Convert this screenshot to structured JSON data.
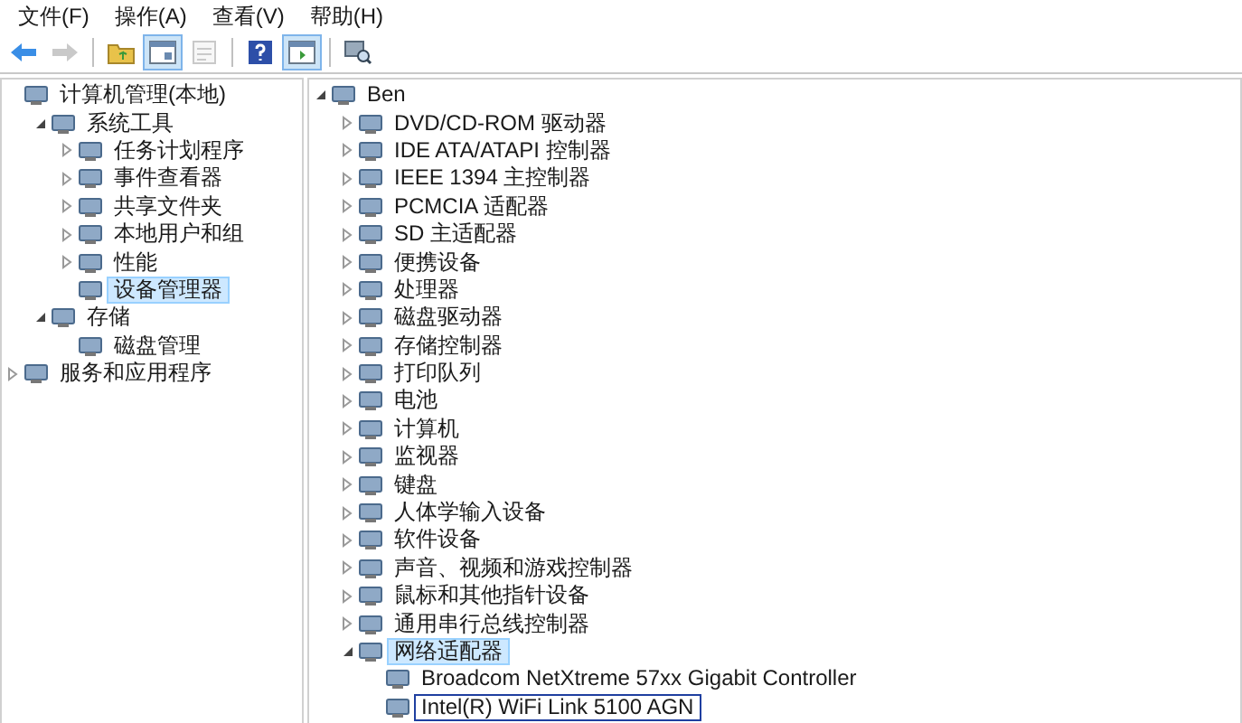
{
  "menu": [
    "文件(F)",
    "操作(A)",
    "查看(V)",
    "帮助(H)"
  ],
  "toolbar": [
    {
      "kind": "back",
      "pressed": false,
      "disabled": false
    },
    {
      "kind": "forward",
      "pressed": false,
      "disabled": true
    },
    {
      "kind": "separator"
    },
    {
      "kind": "up",
      "pressed": false,
      "disabled": false
    },
    {
      "kind": "console",
      "pressed": true,
      "disabled": false
    },
    {
      "kind": "properties",
      "pressed": false,
      "disabled": true
    },
    {
      "kind": "separator"
    },
    {
      "kind": "help",
      "pressed": false,
      "disabled": false
    },
    {
      "kind": "pane",
      "pressed": true,
      "disabled": false
    },
    {
      "kind": "separator"
    },
    {
      "kind": "scan",
      "pressed": false,
      "disabled": false
    }
  ],
  "left_tree": [
    {
      "label": "计算机管理(本地)",
      "selected": false,
      "children": [
        {
          "label": "系统工具",
          "expanded": true,
          "selected": false,
          "children": [
            {
              "label": "任务计划程序",
              "expanded": false,
              "selected": false
            },
            {
              "label": "事件查看器",
              "expanded": false,
              "selected": false
            },
            {
              "label": "共享文件夹",
              "expanded": false,
              "selected": false
            },
            {
              "label": "本地用户和组",
              "expanded": false,
              "selected": false
            },
            {
              "label": "性能",
              "expanded": false,
              "selected": false
            },
            {
              "label": "设备管理器",
              "selected": true
            }
          ]
        },
        {
          "label": "存储",
          "expanded": true,
          "selected": false,
          "children": [
            {
              "label": "磁盘管理",
              "selected": false
            }
          ]
        }
      ]
    },
    {
      "label": "服务和应用程序",
      "expanded": false,
      "selected": false
    }
  ],
  "device_tree": [
    {
      "label": "Ben",
      "expanded": true,
      "selected": false,
      "focused": false,
      "children": [
        {
          "label": "DVD/CD-ROM 驱动器",
          "expanded": false,
          "selected": false,
          "focused": false
        },
        {
          "label": "IDE ATA/ATAPI 控制器",
          "expanded": false,
          "selected": false,
          "focused": false
        },
        {
          "label": "IEEE 1394 主控制器",
          "expanded": false,
          "selected": false,
          "focused": false
        },
        {
          "label": "PCMCIA 适配器",
          "expanded": false,
          "selected": false,
          "focused": false
        },
        {
          "label": "SD 主适配器",
          "expanded": false,
          "selected": false,
          "focused": false
        },
        {
          "label": "便携设备",
          "expanded": false,
          "selected": false,
          "focused": false
        },
        {
          "label": "处理器",
          "expanded": false,
          "selected": false,
          "focused": false
        },
        {
          "label": "磁盘驱动器",
          "expanded": false,
          "selected": false,
          "focused": false
        },
        {
          "label": "存储控制器",
          "expanded": false,
          "selected": false,
          "focused": false
        },
        {
          "label": "打印队列",
          "expanded": false,
          "selected": false,
          "focused": false
        },
        {
          "label": "电池",
          "expanded": false,
          "selected": false,
          "focused": false
        },
        {
          "label": "计算机",
          "expanded": false,
          "selected": false,
          "focused": false
        },
        {
          "label": "监视器",
          "expanded": false,
          "selected": false,
          "focused": false
        },
        {
          "label": "键盘",
          "expanded": false,
          "selected": false,
          "focused": false
        },
        {
          "label": "人体学输入设备",
          "expanded": false,
          "selected": false,
          "focused": false
        },
        {
          "label": "软件设备",
          "expanded": false,
          "selected": false,
          "focused": false
        },
        {
          "label": "声音、视频和游戏控制器",
          "expanded": false,
          "selected": false,
          "focused": false
        },
        {
          "label": "鼠标和其他指针设备",
          "expanded": false,
          "selected": false,
          "focused": false
        },
        {
          "label": "通用串行总线控制器",
          "expanded": false,
          "selected": false,
          "focused": false
        },
        {
          "label": "网络适配器",
          "expanded": true,
          "selected": true,
          "focused": false,
          "children": [
            {
              "label": "Broadcom NetXtreme 57xx Gigabit Controller",
              "selected": false,
              "focused": false
            },
            {
              "label": "Intel(R) WiFi Link 5100 AGN",
              "selected": false,
              "focused": true
            }
          ]
        }
      ]
    }
  ]
}
